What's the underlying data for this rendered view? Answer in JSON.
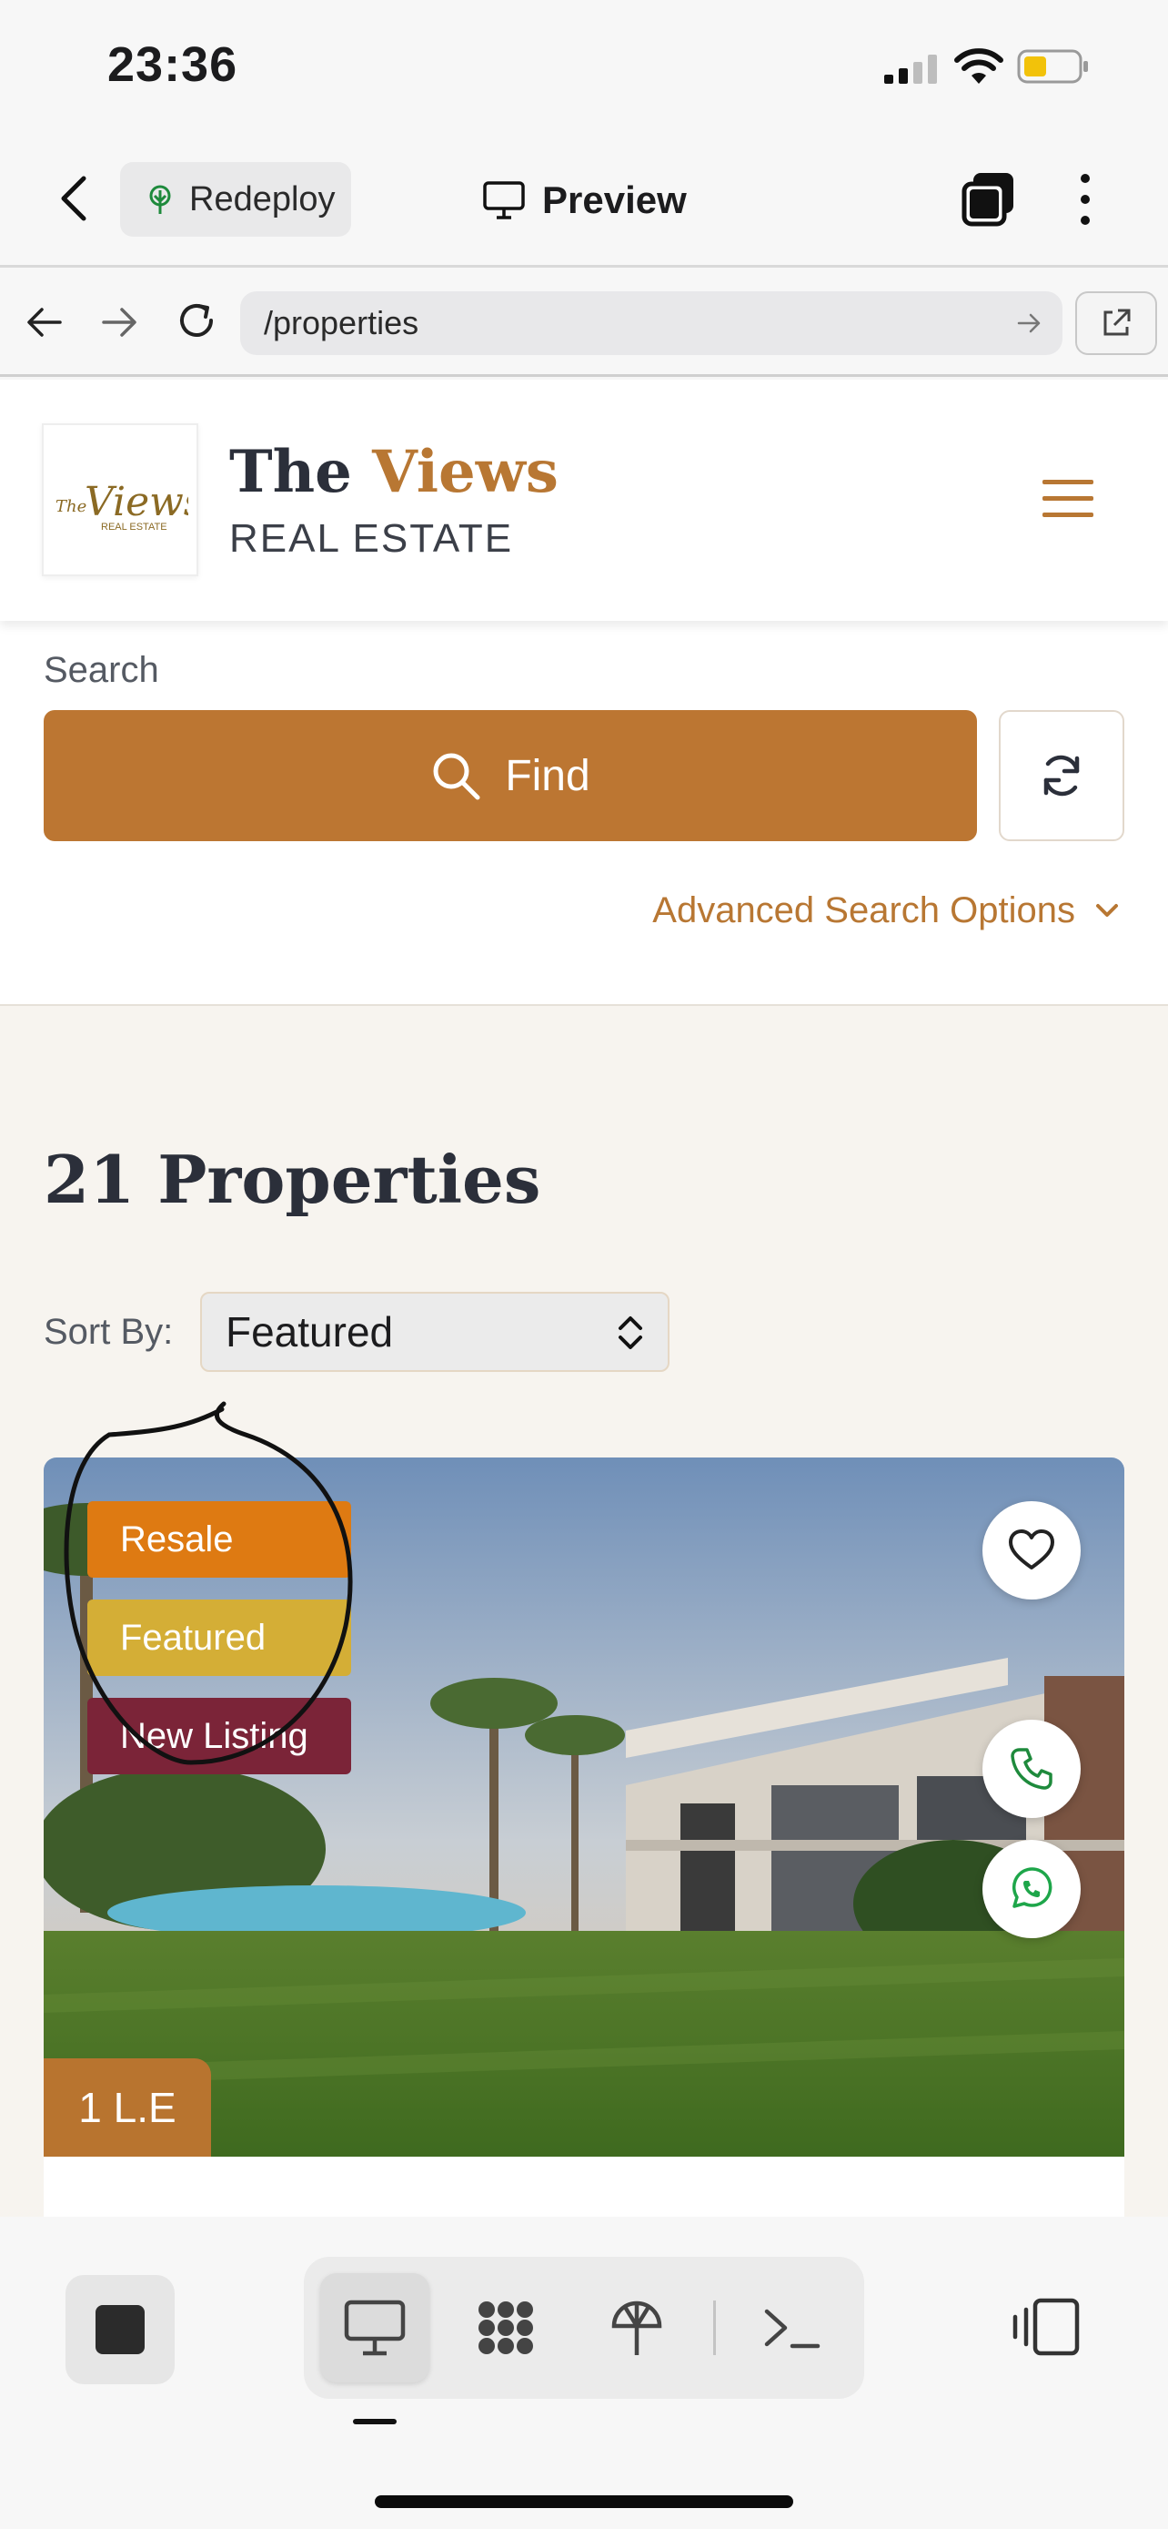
{
  "status_bar": {
    "time": "23:36"
  },
  "app_toolbar": {
    "redeploy_label": "Redeploy",
    "preview_label": "Preview"
  },
  "browser": {
    "url": "/properties"
  },
  "site_header": {
    "brand_prefix": "The",
    "brand_accent": "Views",
    "brand_sub": "REAL ESTATE",
    "logo_text": "The Views",
    "logo_sub": "REAL ESTATE"
  },
  "search": {
    "label": "Search",
    "find_label": "Find",
    "advanced_label": "Advanced Search Options"
  },
  "listings": {
    "count_title": "21 Properties",
    "sort_label": "Sort By:",
    "sort_value": "Featured",
    "cards": [
      {
        "badges": [
          {
            "label": "Resale",
            "color": "#de7a12"
          },
          {
            "label": "Featured",
            "color": "#d4ae36"
          },
          {
            "label": "New Listing",
            "color": "#7b2438"
          }
        ],
        "price": "1 L.E"
      }
    ]
  },
  "colors": {
    "accent": "#bc7632",
    "brand_dark": "#2b2f3a",
    "cream_bg": "#f7f4ef"
  },
  "icons": {
    "back": "chevron-left-icon",
    "redeploy": "deploy-tree-icon",
    "preview": "monitor-icon",
    "tabs": "tabs-icon",
    "more": "more-vertical-icon",
    "reload": "reload-icon",
    "open_external": "open-external-icon",
    "menu": "hamburger-icon",
    "find": "search-icon",
    "reset": "refresh-icon",
    "favorite": "heart-icon",
    "call": "phone-icon",
    "whatsapp": "whatsapp-icon"
  }
}
